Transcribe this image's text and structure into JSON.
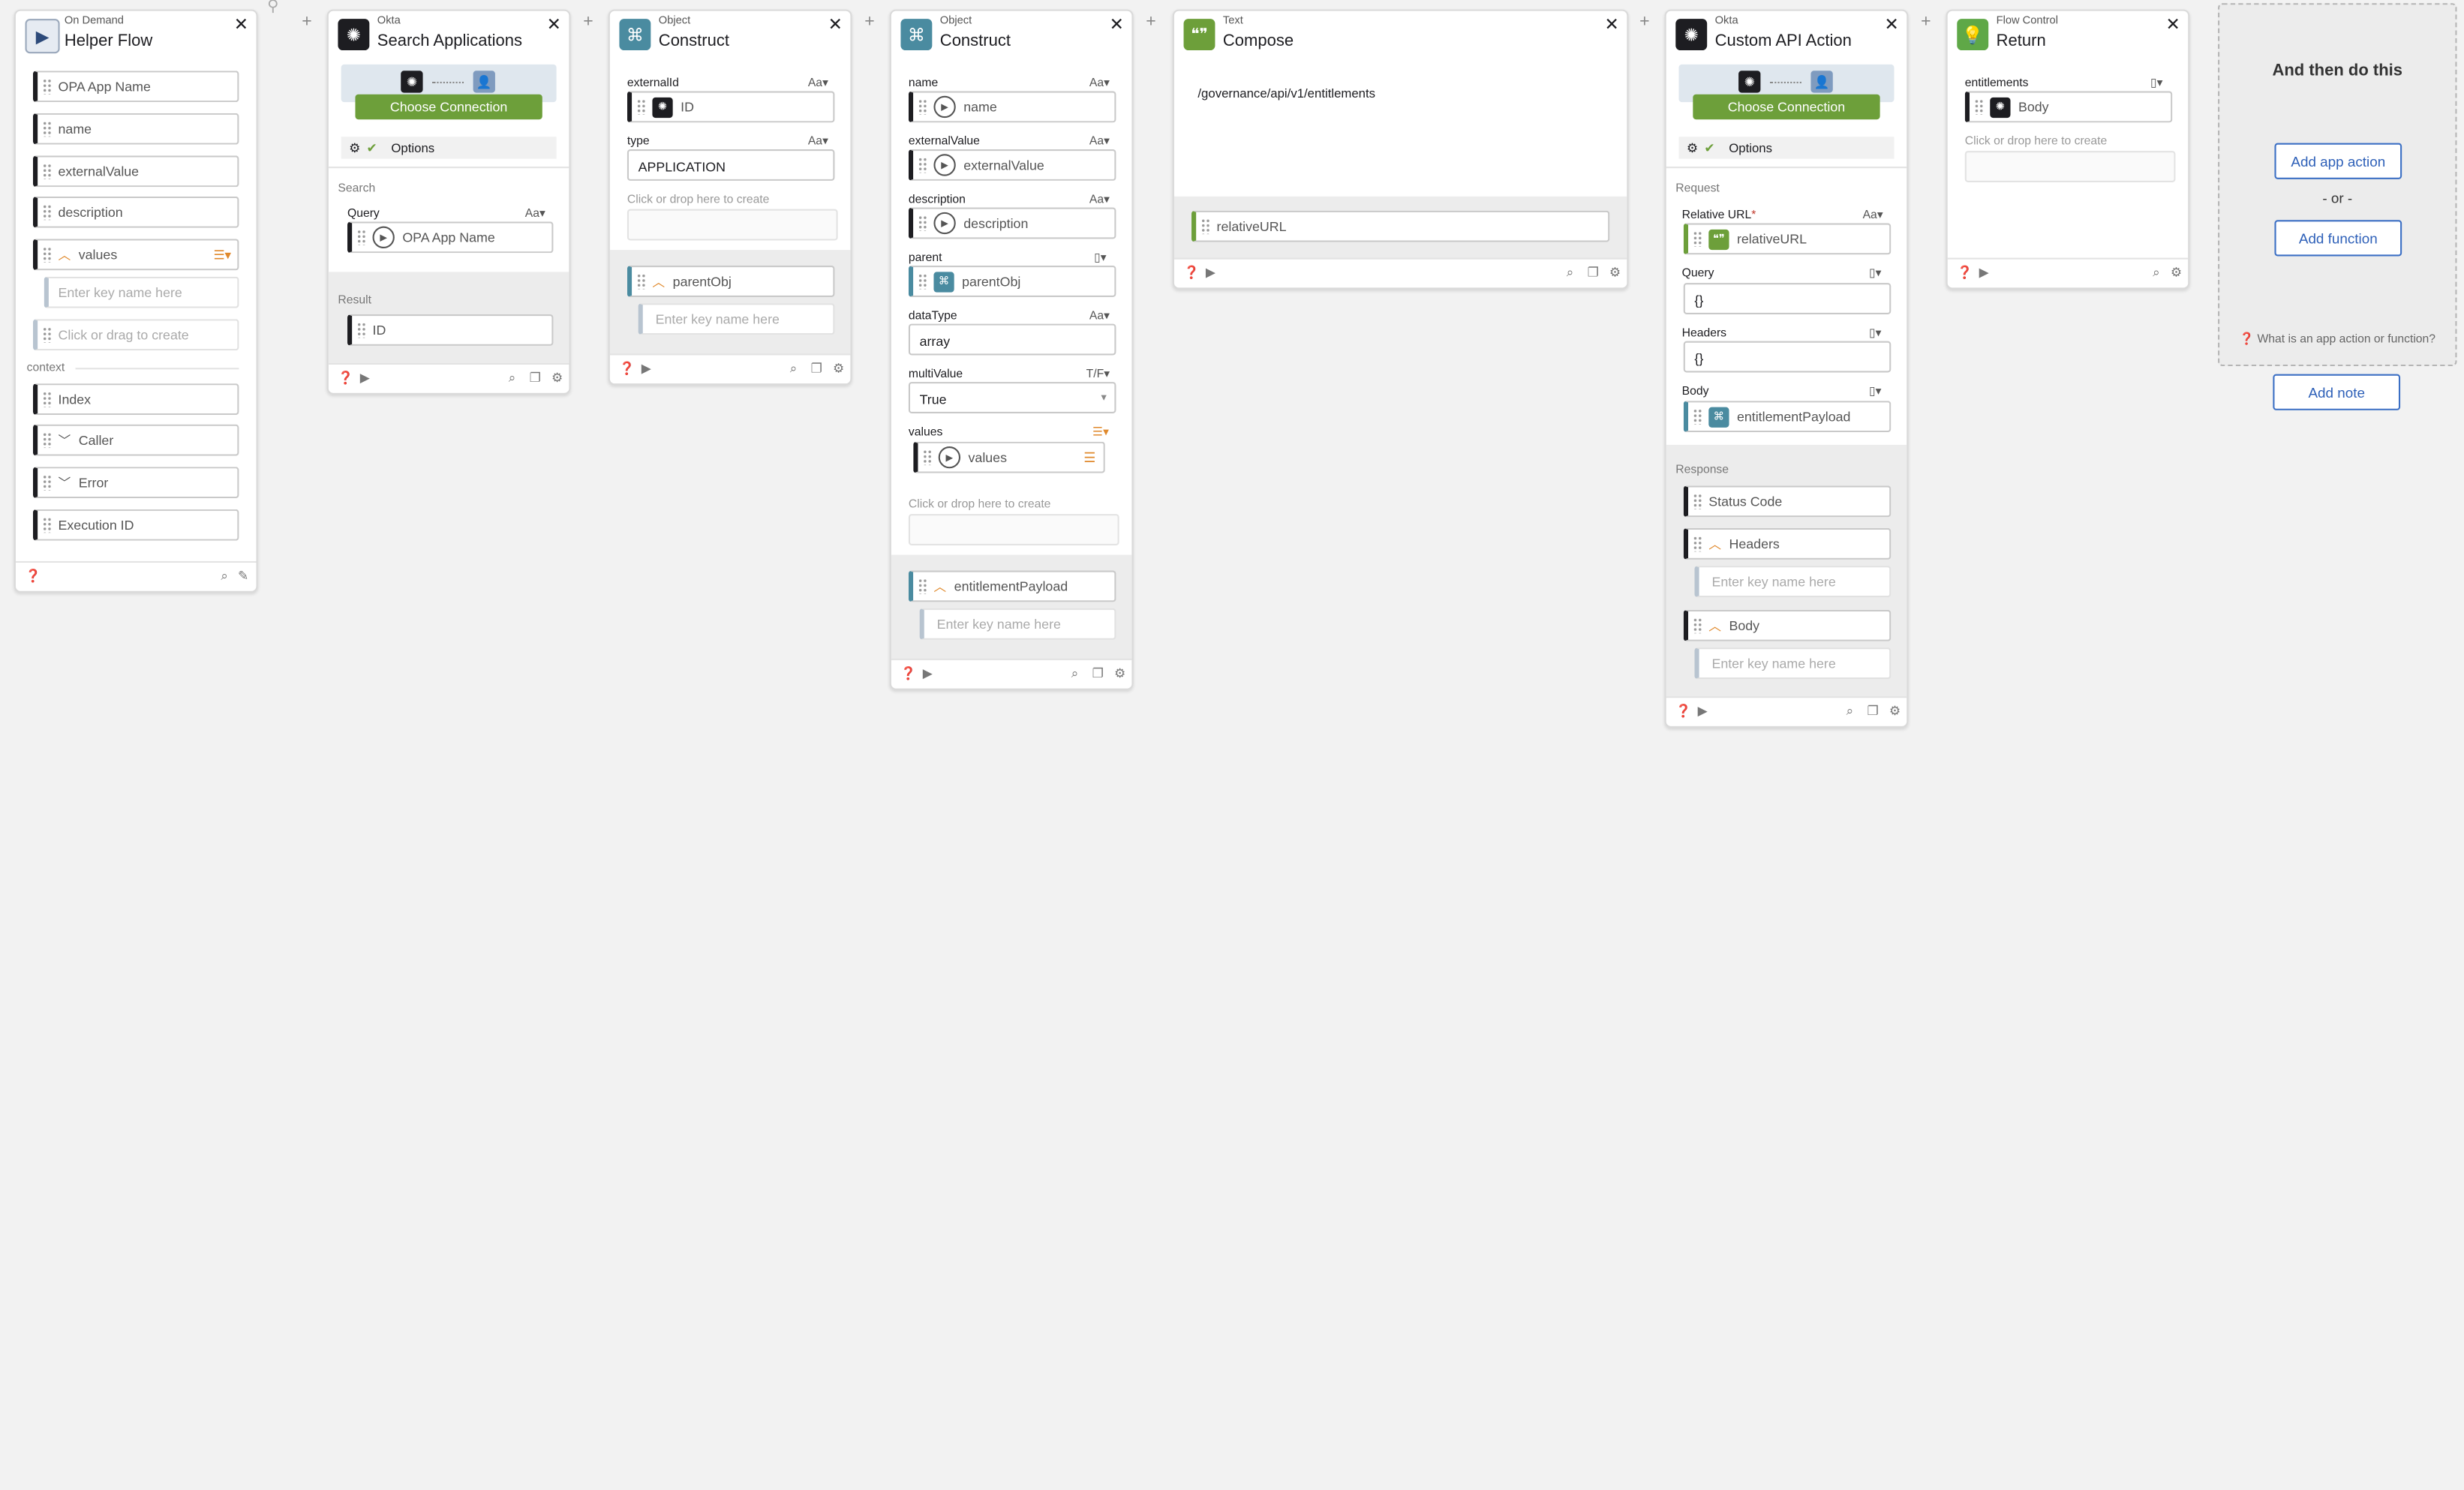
{
  "colors": {
    "accent_green": "#6d9f3a",
    "teal": "#4a8ba0",
    "link_blue": "#2e60b8",
    "list_orange": "#e0892c"
  },
  "cards": {
    "helper": {
      "kind": "On Demand",
      "title": "Helper Flow",
      "fields": [
        "OPA App Name",
        "name",
        "externalValue",
        "description",
        "values"
      ],
      "key_placeholder": "Enter key name here",
      "click_drag": "Click or drag to create",
      "context_label": "context",
      "context_fields": [
        "Index",
        "Caller",
        "Error",
        "Execution ID"
      ]
    },
    "search": {
      "kind": "Okta",
      "title": "Search Applications",
      "choose_connection": "Choose Connection",
      "options": "Options",
      "search_label": "Search",
      "query_label": "Query",
      "aa": "Aa",
      "query_value": "OPA App Name",
      "result_label": "Result",
      "result_field": "ID"
    },
    "construct1": {
      "kind": "Object",
      "title": "Construct",
      "externalId_label": "externalId",
      "externalId_value": "ID",
      "type_label": "type",
      "type_value": "APPLICATION",
      "click_drop": "Click or drop here to create",
      "output": "parentObj",
      "key_placeholder": "Enter key name here",
      "aa": "Aa"
    },
    "construct2": {
      "kind": "Object",
      "title": "Construct",
      "aa": "Aa",
      "name_label": "name",
      "name_value": "name",
      "ext_label": "externalValue",
      "ext_value": "externalValue",
      "desc_label": "description",
      "desc_value": "description",
      "parent_label": "parent",
      "parent_value": "parentObj",
      "datatype_label": "dataType",
      "datatype_value": "array",
      "multi_label": "multiValue",
      "multi_type": "T/F",
      "multi_value": "True",
      "values_label": "values",
      "values_value": "values",
      "click_drop": "Click or drop here to create",
      "output": "entitlementPayload",
      "key_placeholder": "Enter key name here"
    },
    "compose": {
      "kind": "Text",
      "title": "Compose",
      "text": "/governance/api/v1/entitlements",
      "output": "relativeURL"
    },
    "custom": {
      "kind": "Okta",
      "title": "Custom API Action",
      "choose_connection": "Choose Connection",
      "options": "Options",
      "request_label": "Request",
      "relurl_label": "Relative URL",
      "required": "*",
      "aa": "Aa",
      "relurl_value": "relativeURL",
      "query_label": "Query",
      "query_value": "{}",
      "headers_label": "Headers",
      "headers_value": "{}",
      "body_label": "Body",
      "body_value": "entitlementPayload",
      "response_label": "Response",
      "status_code": "Status Code",
      "resp_headers": "Headers",
      "resp_body": "Body",
      "key_placeholder": "Enter key name here"
    },
    "ret": {
      "kind": "Flow Control",
      "title": "Return",
      "ent_label": "entitlements",
      "ent_value": "Body",
      "click_drop": "Click or drop here to create"
    }
  },
  "next": {
    "title": "And then do this",
    "add_app": "Add app action",
    "or": "- or -",
    "add_fn": "Add function",
    "help": "What is an app action or function?",
    "add_note": "Add note"
  }
}
